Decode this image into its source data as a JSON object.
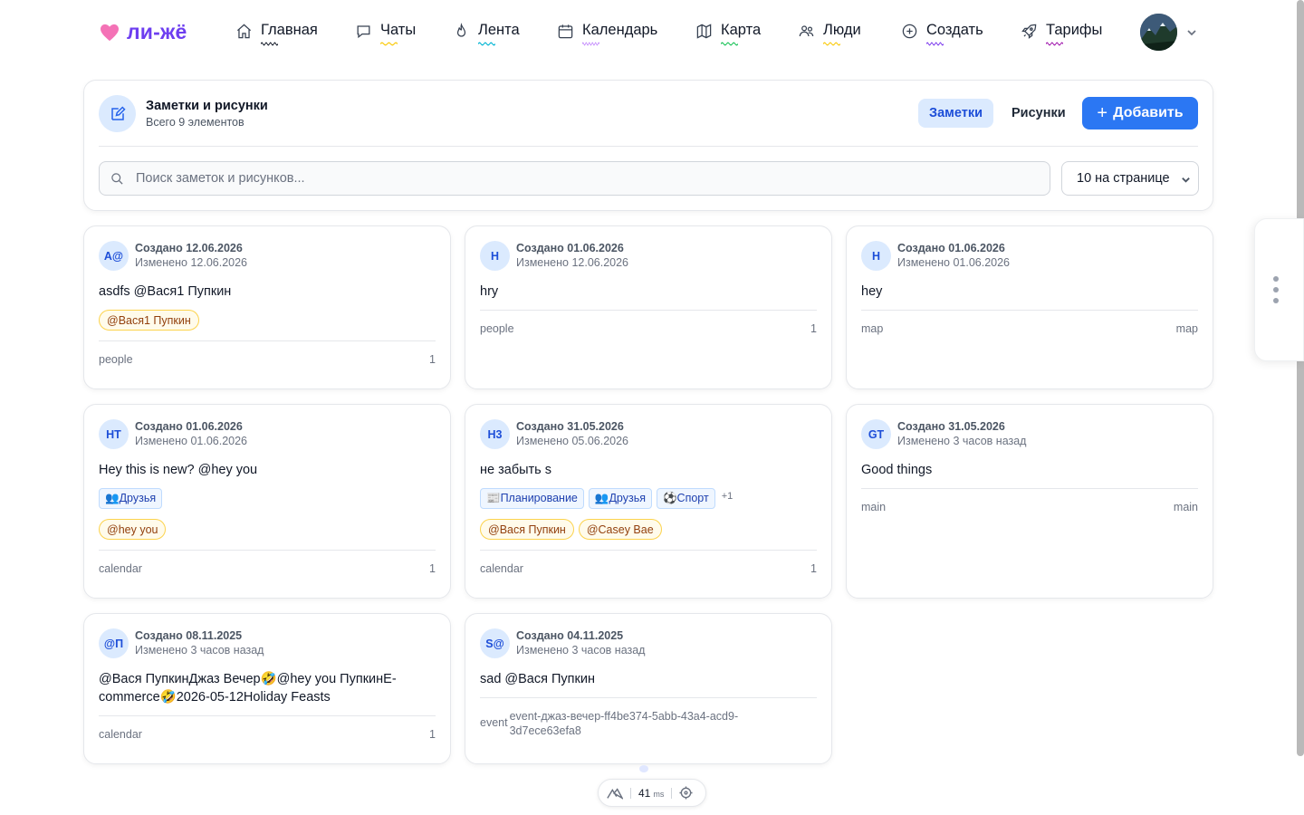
{
  "brand": {
    "name": "ли-жё",
    "accent": "#6d3ef0",
    "heart_color": "#f472b6"
  },
  "nav": [
    {
      "label": "Главная",
      "icon": "home-icon",
      "underline": "#111827"
    },
    {
      "label": "Чаты",
      "icon": "chat-icon",
      "underline": "#facc15"
    },
    {
      "label": "Лента",
      "icon": "flame-icon",
      "underline": "#06b6d4"
    },
    {
      "label": "Календарь",
      "icon": "calendar-icon",
      "underline": "#c084fc"
    },
    {
      "label": "Карта",
      "icon": "map-icon",
      "underline": "#22c55e"
    },
    {
      "label": "Люди",
      "icon": "people-icon",
      "underline": "#facc15"
    },
    {
      "label": "Создать",
      "icon": "plus-circle-icon",
      "underline": "#7c3aed"
    },
    {
      "label": "Тарифы",
      "icon": "rocket-icon",
      "underline": "#a21caf"
    }
  ],
  "panel": {
    "title": "Заметки и рисунки",
    "subtitle": "Всего 9 элементов",
    "icon": "edit-icon",
    "tab_notes": "Заметки",
    "tab_drawings": "Рисунки",
    "add_label": "Добавить",
    "search_placeholder": "Поиск заметок и рисунков...",
    "per_page": "10 на странице",
    "primary_color": "#2b77f3"
  },
  "cards": [
    {
      "avatar": "A@",
      "created": "Создано 12.06.2026",
      "modified": "Изменено 12.06.2026",
      "text": "asdfs @Вася1 Пупкин",
      "tags": [],
      "mentions": [
        "@Вася1 Пупкин"
      ],
      "footer_left": "people",
      "footer_right": "1"
    },
    {
      "avatar": "H",
      "created": "Создано 01.06.2026",
      "modified": "Изменено 12.06.2026",
      "text": "hry",
      "tags": [],
      "mentions": [],
      "footer_left": "people",
      "footer_right": "1"
    },
    {
      "avatar": "H",
      "created": "Создано 01.06.2026",
      "modified": "Изменено 01.06.2026",
      "text": "hey",
      "tags": [],
      "mentions": [],
      "footer_left": "map",
      "footer_right": "map"
    },
    {
      "avatar": "HT",
      "created": "Создано 01.06.2026",
      "modified": "Изменено 01.06.2026",
      "text": "Hey this is new? @hey you",
      "tags": [
        "👥Друзья"
      ],
      "mentions": [
        "@hey you"
      ],
      "footer_left": "calendar",
      "footer_right": "1"
    },
    {
      "avatar": "Н3",
      "created": "Создано 31.05.2026",
      "modified": "Изменено 05.06.2026",
      "text": "не забыть s",
      "tags": [
        "📰Планирование",
        "👥Друзья",
        "⚽Спорт"
      ],
      "tags_more": "+1",
      "mentions": [
        "@Вася Пупкин",
        "@Casey Bae"
      ],
      "footer_left": "calendar",
      "footer_right": "1"
    },
    {
      "avatar": "GT",
      "created": "Создано 31.05.2026",
      "modified": "Изменено 3 часов назад",
      "text": "Good things",
      "tags": [],
      "mentions": [],
      "footer_left": "main",
      "footer_right": "main"
    },
    {
      "avatar": "@П",
      "created": "Создано 08.11.2025",
      "modified": "Изменено 3 часов назад",
      "text": "@Вася ПупкинДжаз Вечер🤣@hey you ПупкинE-commerce🤣2026-05-12Holiday Feasts",
      "tags": [],
      "mentions": [],
      "footer_left": "calendar",
      "footer_right": "1"
    },
    {
      "avatar": "S@",
      "created": "Создано 04.11.2025",
      "modified": "Изменено 3 часов назад",
      "text": "sad @Вася Пупкин",
      "tags": [],
      "mentions": [],
      "footer_left": "event",
      "footer_right": "event-джаз-вечер-ff4be374-5abb-43a4-acd9-3d7ece63efa8"
    }
  ],
  "bottom_widget": {
    "value": "41",
    "unit": "ms",
    "left_icon": "mountain-icon",
    "right_icon": "crosshair-icon"
  }
}
